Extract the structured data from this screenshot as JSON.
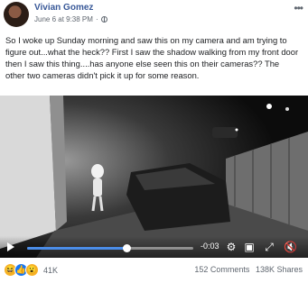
{
  "post": {
    "author": "Vivian Gomez",
    "timestamp": "June 6 at 9:38 PM",
    "privacy_icon": "globe-icon",
    "more_icon": "ellipsis-icon",
    "text": "So I woke up Sunday morning and saw this on my camera and am trying to figure out...what the heck?? First I saw the shadow walking from my front door then I saw this thing....has anyone else seen this on their cameras?? The other two cameras didn't pick it up for some reason."
  },
  "video": {
    "time_remaining": "-0:03",
    "progress_fraction": 0.6,
    "icons": [
      "play-icon",
      "settings-icon",
      "fullscreen-icon",
      "volume-muted-icon"
    ]
  },
  "footer": {
    "reactions": [
      "haha",
      "like",
      "wow"
    ],
    "reaction_count": "41K",
    "comments": "152 Comments",
    "shares": "138K Shares"
  },
  "colors": {
    "link": "#385898",
    "accent": "#4b8de8",
    "muted": "#606770"
  }
}
